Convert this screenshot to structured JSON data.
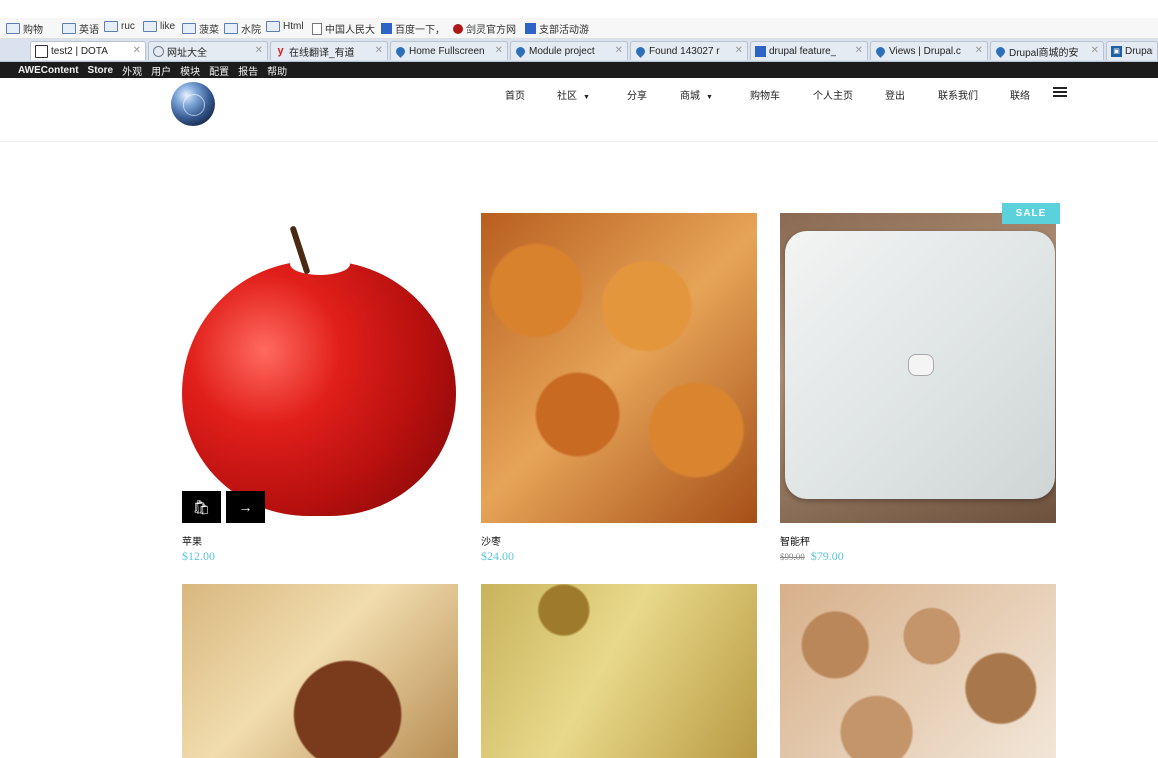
{
  "bookmarks": [
    {
      "label": "购物",
      "icon": "folder-icon"
    },
    {
      "label": "英语",
      "icon": "folder-icon"
    },
    {
      "label": "ruc",
      "icon": "folder-icon"
    },
    {
      "label": "like",
      "icon": "folder-icon"
    },
    {
      "label": "菠菜",
      "icon": "folder-icon"
    },
    {
      "label": "水院",
      "icon": "folder-icon"
    },
    {
      "label": "Html",
      "icon": "folder-icon"
    },
    {
      "label": "中国人民大",
      "icon": "page-icon"
    },
    {
      "label": "百度一下，",
      "icon": "baidu-icon"
    },
    {
      "label": "剑灵官方网",
      "icon": "red-circle-icon"
    },
    {
      "label": "支部活动游",
      "icon": "baidu-icon"
    }
  ],
  "tabs": [
    {
      "label": "test2 | DOTA",
      "icon": "home-icon",
      "active": true
    },
    {
      "label": "网址大全",
      "icon": "globe-icon"
    },
    {
      "label": "在线翻译_有道",
      "icon": "youdao-icon"
    },
    {
      "label": "Home Fullscreen",
      "icon": "drupal-icon"
    },
    {
      "label": "Module project",
      "icon": "drupal-icon"
    },
    {
      "label": "Found 143027 r",
      "icon": "drupal-icon"
    },
    {
      "label": "drupal feature_",
      "icon": "baidu-icon"
    },
    {
      "label": "Views | Drupal.c",
      "icon": "drupal-icon"
    },
    {
      "label": "Drupal商城的安",
      "icon": "drupal-icon"
    },
    {
      "label": "Drupal",
      "icon": "blue-square-icon"
    }
  ],
  "admin": {
    "items": [
      "AWEContent",
      "Store",
      "外观",
      "用户",
      "模块",
      "配置",
      "报告",
      "帮助"
    ]
  },
  "nav": {
    "home": "首页",
    "community": "社区",
    "share": "分享",
    "shop": "商城",
    "cart": "购物车",
    "profile": "个人主页",
    "logout": "登出",
    "contact": "联系我们",
    "link": "联络"
  },
  "products": [
    {
      "title": "苹果",
      "price": "$12.00",
      "image": "apple"
    },
    {
      "title": "沙枣",
      "price": "$24.00",
      "image": "dates"
    },
    {
      "title": "智能秤",
      "old_price": "$99.00",
      "price": "$79.00",
      "badge": "SALE",
      "image": "smart-scale"
    },
    {
      "title": "",
      "price": "",
      "image": "figs"
    },
    {
      "title": "",
      "price": "",
      "image": "raisins"
    },
    {
      "title": "",
      "price": "",
      "image": "walnuts"
    }
  ],
  "colors": {
    "accent": "#5bd1dc",
    "admin_bar": "#1c1c1c",
    "price": "#5bc8d6"
  }
}
